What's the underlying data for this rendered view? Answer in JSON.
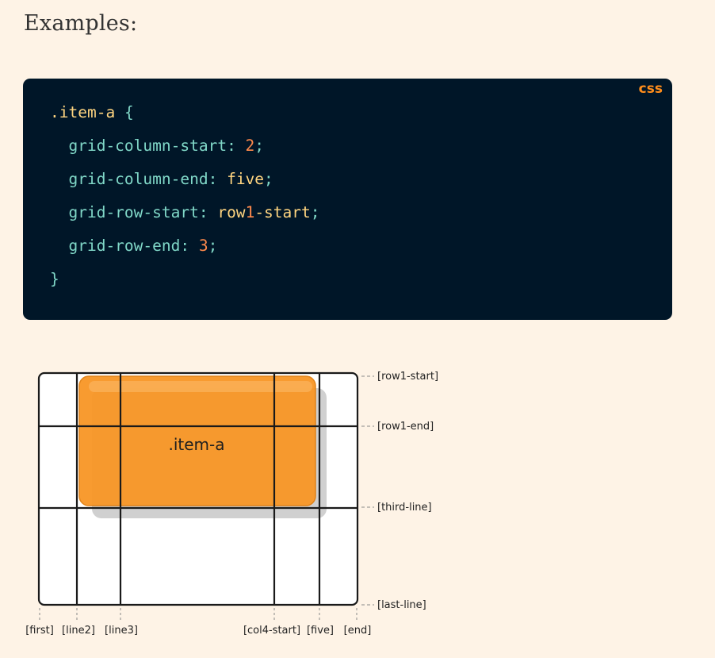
{
  "page": {
    "heading": "Examples:"
  },
  "code": {
    "language": "css",
    "lines": [
      [
        {
          "t": ".item-a",
          "c": "sel"
        },
        {
          "t": " ",
          "c": "punct"
        },
        {
          "t": "{",
          "c": "brace"
        }
      ],
      [
        {
          "t": "  grid-column-start",
          "c": "prop"
        },
        {
          "t": ": ",
          "c": "punct"
        },
        {
          "t": "2",
          "c": "num"
        },
        {
          "t": ";",
          "c": "punct"
        }
      ],
      [
        {
          "t": "  grid-column-end",
          "c": "prop"
        },
        {
          "t": ": ",
          "c": "punct"
        },
        {
          "t": "five",
          "c": "val"
        },
        {
          "t": ";",
          "c": "punct"
        }
      ],
      [
        {
          "t": "  grid-row-start",
          "c": "prop"
        },
        {
          "t": ": ",
          "c": "punct"
        },
        {
          "t": "row",
          "c": "val"
        },
        {
          "t": "1",
          "c": "num"
        },
        {
          "t": "-start",
          "c": "val"
        },
        {
          "t": ";",
          "c": "punct"
        }
      ],
      [
        {
          "t": "  grid-row-end",
          "c": "prop"
        },
        {
          "t": ": ",
          "c": "punct"
        },
        {
          "t": "3",
          "c": "num"
        },
        {
          "t": ";",
          "c": "punct"
        }
      ],
      [
        {
          "t": "}",
          "c": "brace"
        }
      ]
    ]
  },
  "diagram": {
    "item_label": ".item-a",
    "row_lines": [
      "[row1-start]",
      "[row1-end]",
      "[third-line]",
      "[last-line]"
    ],
    "column_lines": [
      "[first]",
      "[line2]",
      "[line3]",
      "[col4-start]",
      "[five]",
      "[end]"
    ],
    "colors": {
      "item_fill": "#f89728",
      "item_border": "#e07f12",
      "grid_line": "#1a1a1a",
      "shadow": "#c8c8c8"
    }
  }
}
